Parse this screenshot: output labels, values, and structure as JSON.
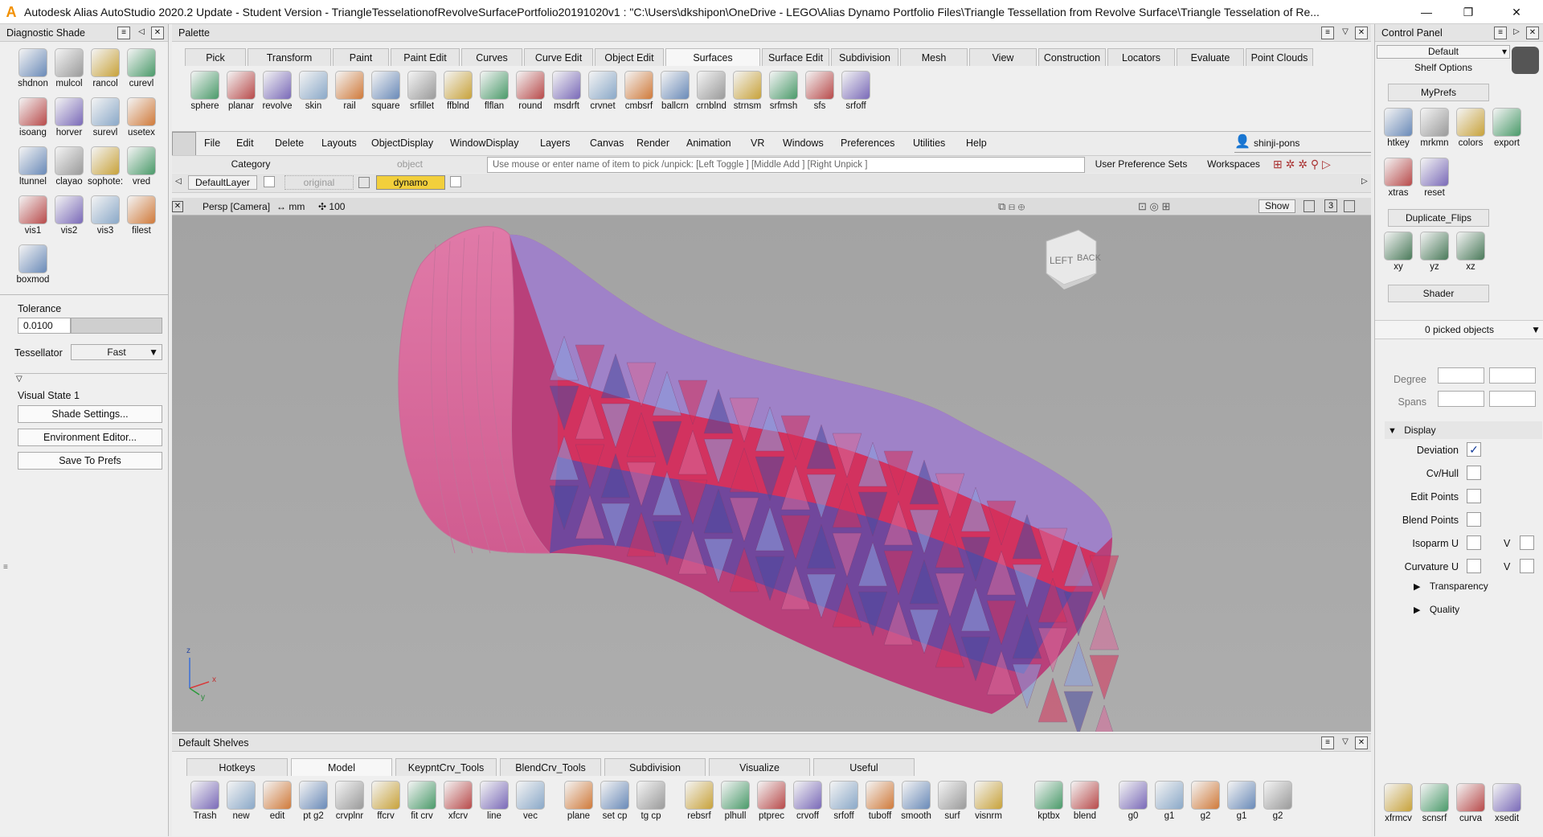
{
  "window": {
    "title": "Autodesk Alias AutoStudio 2020.2 Update - Student Version   - TriangleTesselationofRevolveSurfacePortfolio20191020v1 : \"C:\\Users\\dkshipon\\OneDrive - LEGO\\Alias Dynamo Portfolio Files\\Triangle Tessellation from Revolve Surface\\Triangle Tesselation of Re...",
    "minimize": "—",
    "maximize": "❐",
    "close": "✕"
  },
  "diag": {
    "header": "Diagnostic Shade",
    "tools": [
      "shdnon",
      "mulcol",
      "rancol",
      "curevl",
      "isoang",
      "horver",
      "surevl",
      "usetex",
      "ltunnel",
      "clayao",
      "sophote:",
      "vred",
      "vis1",
      "vis2",
      "vis3",
      "filest",
      "boxmod"
    ],
    "tolerance_label": "Tolerance",
    "tolerance_value": "0.0100",
    "tessellator_label": "Tessellator",
    "tessellator_value": "Fast",
    "visual_state": "Visual State 1",
    "btn_shade": "Shade Settings...",
    "btn_env": "Environment Editor...",
    "btn_save": "Save To Prefs"
  },
  "palette": {
    "header": "Palette",
    "tabs": [
      "Pick",
      "Transform",
      "Paint",
      "Paint Edit",
      "Curves",
      "Curve Edit",
      "Object Edit",
      "Surfaces",
      "Surface Edit",
      "Subdivision",
      "Mesh",
      "View",
      "Construction",
      "Locators",
      "Evaluate",
      "Point Clouds"
    ],
    "active_tab": "Surfaces",
    "tools": [
      "sphere",
      "planar",
      "revolve",
      "skin",
      "rail",
      "square",
      "srfillet",
      "ffblnd",
      "flflan",
      "round",
      "msdrft",
      "crvnet",
      "cmbsrf",
      "ballcrn",
      "crnblnd",
      "strnsm",
      "srfmsh",
      "sfs",
      "srfoff"
    ]
  },
  "menu": {
    "items": [
      "File",
      "Edit",
      "Delete",
      "Layouts",
      "ObjectDisplay",
      "WindowDisplay",
      "Layers",
      "Canvas",
      "Render",
      "Animation",
      "VR",
      "Windows",
      "Preferences",
      "Utilities",
      "Help"
    ],
    "user": "shinji-pons",
    "object_label": "object",
    "category_label": "Category",
    "category_value": "object",
    "pick_prompt": "Use mouse or enter name of item to pick /unpick: [Left Toggle ] [Middle Add ] [Right Unpick ]",
    "user_pref_sets": "User Preference Sets",
    "workspaces": "Workspaces",
    "layers": [
      "DefaultLayer",
      "original",
      "dynamo"
    ]
  },
  "view": {
    "camera": "Persp [Camera]",
    "units": "mm",
    "zoom": "100",
    "show": "Show",
    "count": "3",
    "cube_left": "LEFT",
    "cube_back": "BACK",
    "axis_z": "z",
    "axis_x": "x",
    "axis_y": "y"
  },
  "shelves": {
    "header": "Default Shelves",
    "tabs": [
      "Hotkeys",
      "Model",
      "KeypntCrv_Tools",
      "BlendCrv_Tools",
      "Subdivision",
      "Visualize",
      "Useful"
    ],
    "active_tab": "Model",
    "tools": [
      "Trash",
      "new",
      "edit",
      "pt g2",
      "crvplnr",
      "ffcrv",
      "fit crv",
      "xfcrv",
      "line",
      "vec",
      "plane",
      "set cp",
      "tg cp",
      "rebsrf",
      "plhull",
      "ptprec",
      "crvoff",
      "srfoff",
      "tuboff",
      "smooth",
      "surf",
      "visnrm",
      "kptbx",
      "blend",
      "g0",
      "g1",
      "g2",
      "g1",
      "g2"
    ]
  },
  "control": {
    "header": "Control Panel",
    "default_value": "Default",
    "shelf_options": "Shelf Options",
    "myprefs": "MyPrefs",
    "myprefs_tools": [
      "htkey",
      "mrkmn",
      "colors",
      "export",
      "xtras",
      "reset"
    ],
    "dup_flips": "Duplicate_Flips",
    "dup_tools": [
      "xy",
      "yz",
      "xz"
    ],
    "shader": "Shader",
    "picked": "0 picked objects",
    "degree": "Degree",
    "spans": "Spans",
    "display": "Display",
    "rows": [
      {
        "label": "Deviation",
        "checked": "✓"
      },
      {
        "label": "Cv/Hull",
        "checked": ""
      },
      {
        "label": "Edit Points",
        "checked": ""
      },
      {
        "label": "Blend Points",
        "checked": ""
      },
      {
        "label": "Isoparm U",
        "checked": ""
      },
      {
        "label": "Curvature U",
        "checked": ""
      }
    ],
    "v_label": "V",
    "transparency": "Transparency",
    "quality": "Quality",
    "bottom_tools": [
      "xfrmcv",
      "scnsrf",
      "curva",
      "xsedit"
    ]
  },
  "colors": {
    "accent": "#f2cf3c",
    "mesh_pink": "#d8699a",
    "mesh_red": "#d6305a",
    "mesh_blue": "#4a4aa0",
    "mesh_light": "#8aa0e0"
  }
}
